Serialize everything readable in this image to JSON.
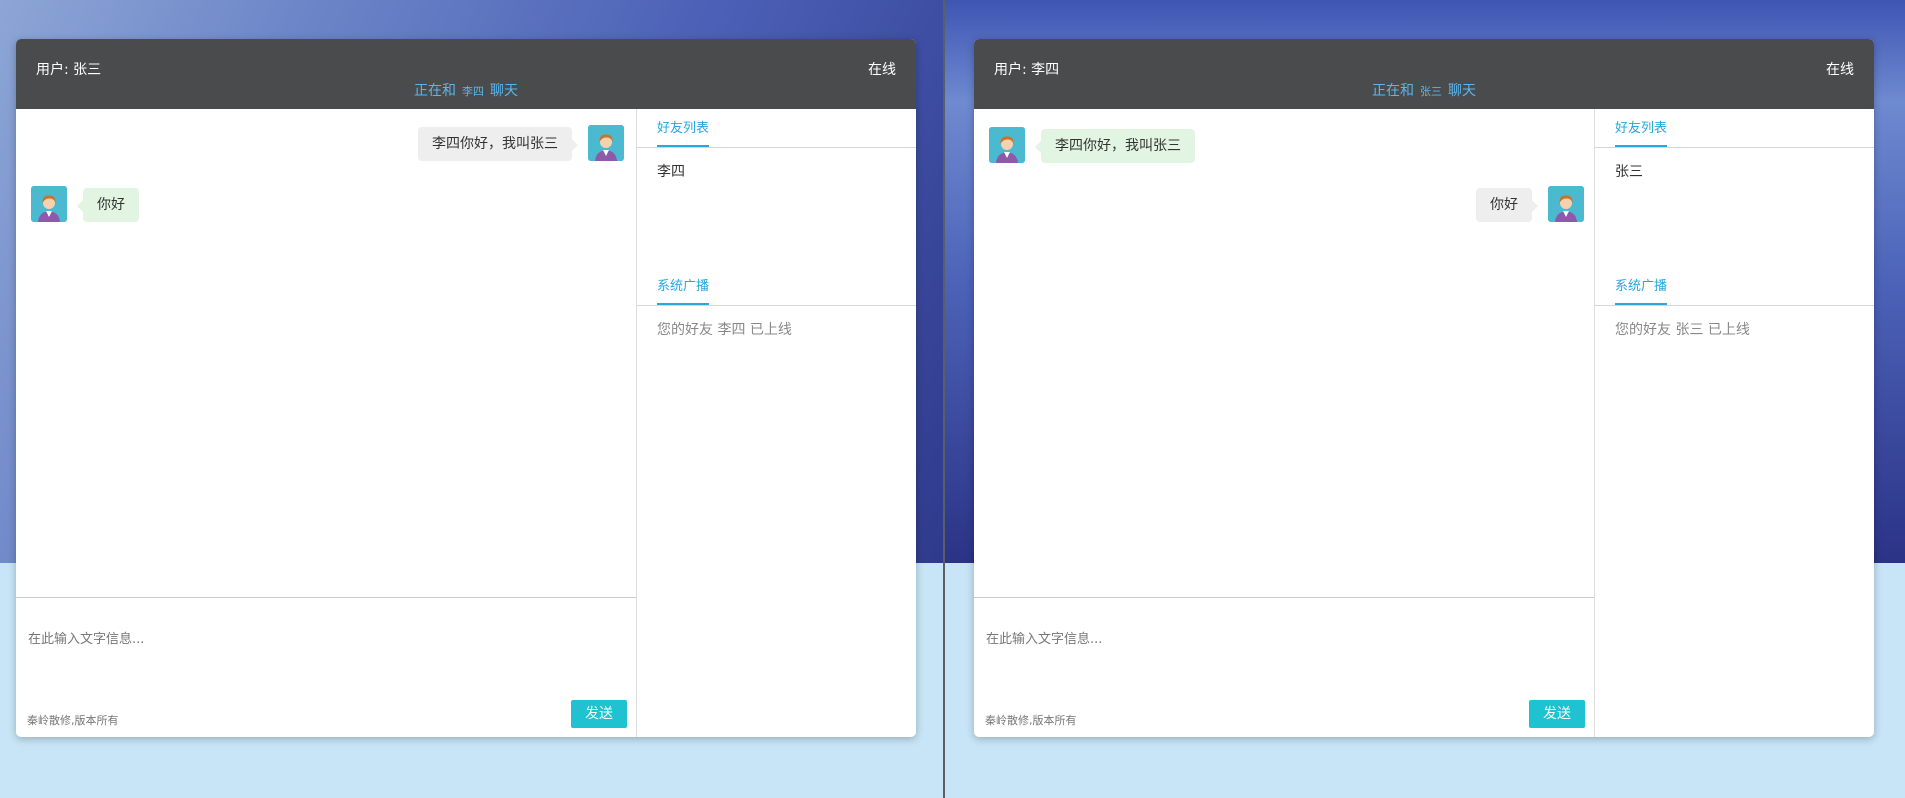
{
  "left": {
    "user_label": "用户: 张三",
    "status": "在线",
    "chat_prefix": "正在和",
    "chat_peer": "李四",
    "chat_suffix": "聊天",
    "messages": [
      {
        "from": "me",
        "text": "李四你好，我叫张三"
      },
      {
        "from": "them",
        "text": "你好"
      }
    ],
    "input_placeholder": "在此输入文字信息...",
    "copyright": "秦岭散修,版本所有",
    "send_label": "发送",
    "friends_tab": "好友列表",
    "friends": [
      "李四"
    ],
    "broadcast_tab": "系统广播",
    "broadcast_text": "您的好友  李四  已上线"
  },
  "right": {
    "user_label": "用户: 李四",
    "status": "在线",
    "chat_prefix": "正在和",
    "chat_peer": "张三",
    "chat_suffix": "聊天",
    "messages": [
      {
        "from": "them",
        "text": "李四你好，我叫张三"
      },
      {
        "from": "me",
        "text": "你好"
      }
    ],
    "input_placeholder": "在此输入文字信息...",
    "copyright": "秦岭散修,版本所有",
    "send_label": "发送",
    "friends_tab": "好友列表",
    "friends": [
      "张三"
    ],
    "broadcast_tab": "系统广播",
    "broadcast_text": "您的好友  张三  已上线"
  },
  "colors": {
    "header_bg": "#4a4b4d",
    "accent_blue": "#27a6df",
    "send_button": "#1fc2d0",
    "bubble_sent": "#eeeeee",
    "bubble_received": "#e2f5e2"
  },
  "icons": {
    "avatar": "user-avatar-icon"
  }
}
